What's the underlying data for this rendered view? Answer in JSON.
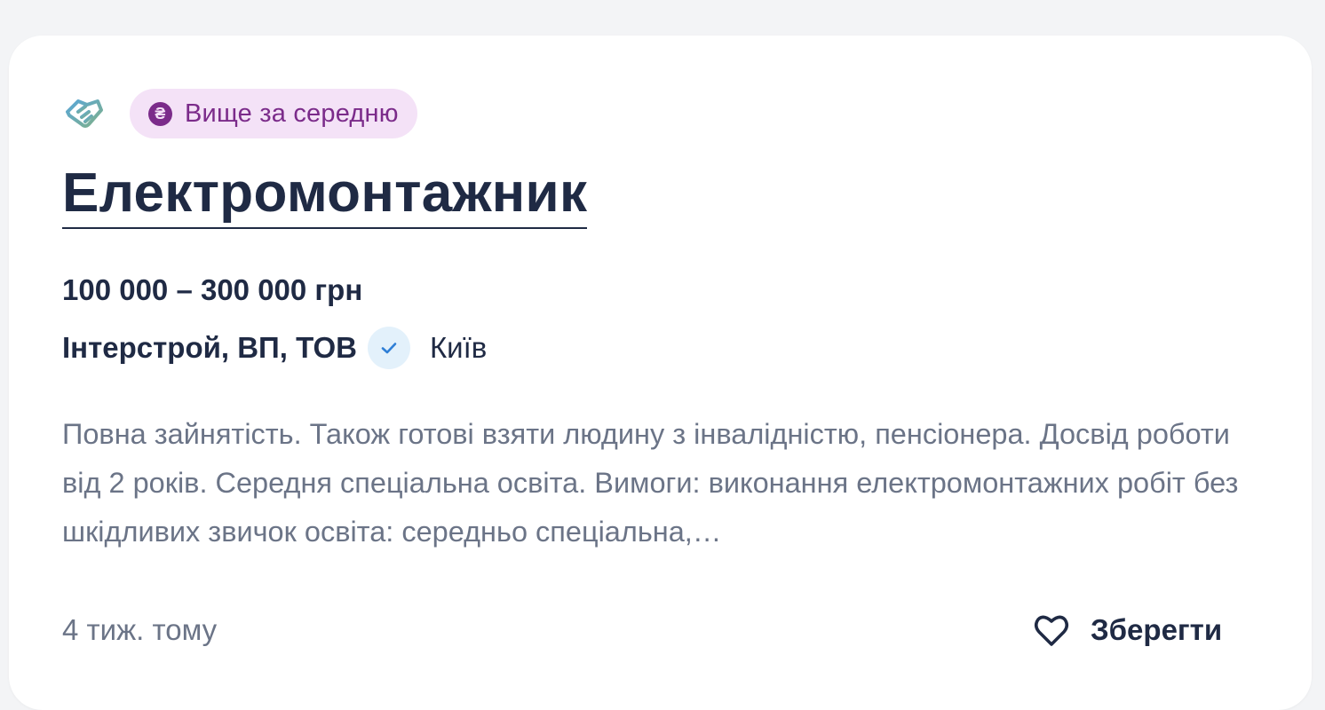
{
  "vacancy": {
    "badge": {
      "icon": "hryvnia-coin-icon",
      "label": "Вище за середню",
      "bg_color": "#f4e2f7",
      "text_color": "#7b2b8a"
    },
    "category_icon": "handshake-icon",
    "title": "Електромонтажник",
    "salary": "100 000 – 300 000 грн",
    "company": "Інтерстрой, ВП, ТОВ",
    "verified_icon": "check-verified-icon",
    "city": "Київ",
    "description": "Повна зайнятість. Також готові взяти людину з інвалідністю, пенсіонера. Досвід роботи від 2 років. Середня спеціальна освіта. Вимоги: виконання електромонтажних робіт без шкідливих звичок освіта: середньо спеціальна,…",
    "posted": "4 тиж. тому",
    "save_label": "Зберегти",
    "save_icon": "heart-icon"
  },
  "colors": {
    "page_bg": "#f3f4f6",
    "card_bg": "#ffffff",
    "text_primary": "#1f2a44",
    "text_secondary": "#6b7487",
    "verified_bg": "#e3f1fb",
    "verified_check": "#2f7fd6"
  }
}
